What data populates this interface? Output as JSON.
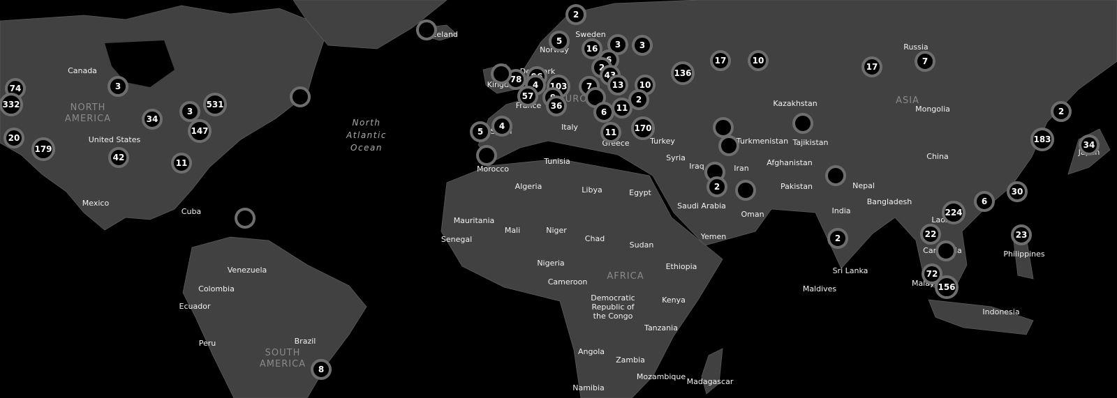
{
  "map": {
    "colors": {
      "background": "#000000",
      "land": "#414141",
      "marker_fill": "#000000",
      "marker_ring": "#6e6e6e",
      "label": "#f2f2f2"
    },
    "continent_labels": [
      {
        "lines": [
          "NORTH",
          "AMERICA"
        ],
        "lon": -100,
        "lat": 48
      },
      {
        "lines": [
          "SOUTH",
          "AMERICA"
        ],
        "lon": -58,
        "lat": -12
      },
      {
        "lines": [
          "EUROPE"
        ],
        "lon": 15,
        "lat": 50
      },
      {
        "lines": [
          "AFRICA"
        ],
        "lon": 22,
        "lat": 3
      },
      {
        "lines": [
          "ASIA"
        ],
        "lon": 90,
        "lat": 47
      }
    ],
    "ocean_labels": [
      {
        "lines": [
          "North",
          "Atlantic",
          "Ocean"
        ]
      }
    ],
    "place_labels": [
      "Canada",
      "United States",
      "Mexico",
      "Cuba",
      "Venezuela",
      "Colombia",
      "Ecuador",
      "Peru",
      "Brazil",
      "Iceland",
      "Sweden",
      "Norway",
      "Denmark",
      "United Kingdom",
      "France",
      "Spain",
      "Italy",
      "Greece",
      "Turkey",
      "Morocco",
      "Tunisia",
      "Algeria",
      "Libya",
      "Egypt",
      "Mauritania",
      "Mali",
      "Niger",
      "Chad",
      "Sudan",
      "Senegal",
      "Nigeria",
      "Ethiopia",
      "Cameroon",
      "Democratic Republic of the Congo",
      "Kenya",
      "Tanzania",
      "Angola",
      "Zambia",
      "Mozambique",
      "Madagascar",
      "Namibia",
      "Syria",
      "Iraq",
      "Iran",
      "Saudi Arabia",
      "Oman",
      "Yemen",
      "Kazakhstan",
      "Turkmenistan",
      "Tajikistan",
      "Afghanistan",
      "Pakistan",
      "Nepal",
      "India",
      "Bangladesh",
      "Sri Lanka",
      "Maldives",
      "Russia",
      "Mongolia",
      "China",
      "Laos",
      "Cambodia",
      "Philippines",
      "Malaysia",
      "Indonesia",
      "Japan"
    ],
    "clusters": [
      "74",
      "332",
      "3",
      "3",
      "531",
      "34",
      "147",
      "20",
      "179",
      "42",
      "11",
      "",
      "",
      "8",
      "",
      "2",
      "5",
      "16",
      "3",
      "3",
      "6",
      "2",
      "43",
      "96",
      "78",
      "",
      "4",
      "103",
      "7",
      "13",
      "10",
      "57",
      "9",
      "",
      "36",
      "2",
      "6",
      "11",
      "170",
      "11",
      "5",
      "4",
      "",
      "",
      "",
      "",
      "2",
      "",
      "136",
      "17",
      "10",
      "17",
      "7",
      "",
      "",
      "2",
      "2",
      "183",
      "34",
      "30",
      "6",
      "224",
      "22",
      "23",
      "",
      "72",
      "156"
    ]
  }
}
